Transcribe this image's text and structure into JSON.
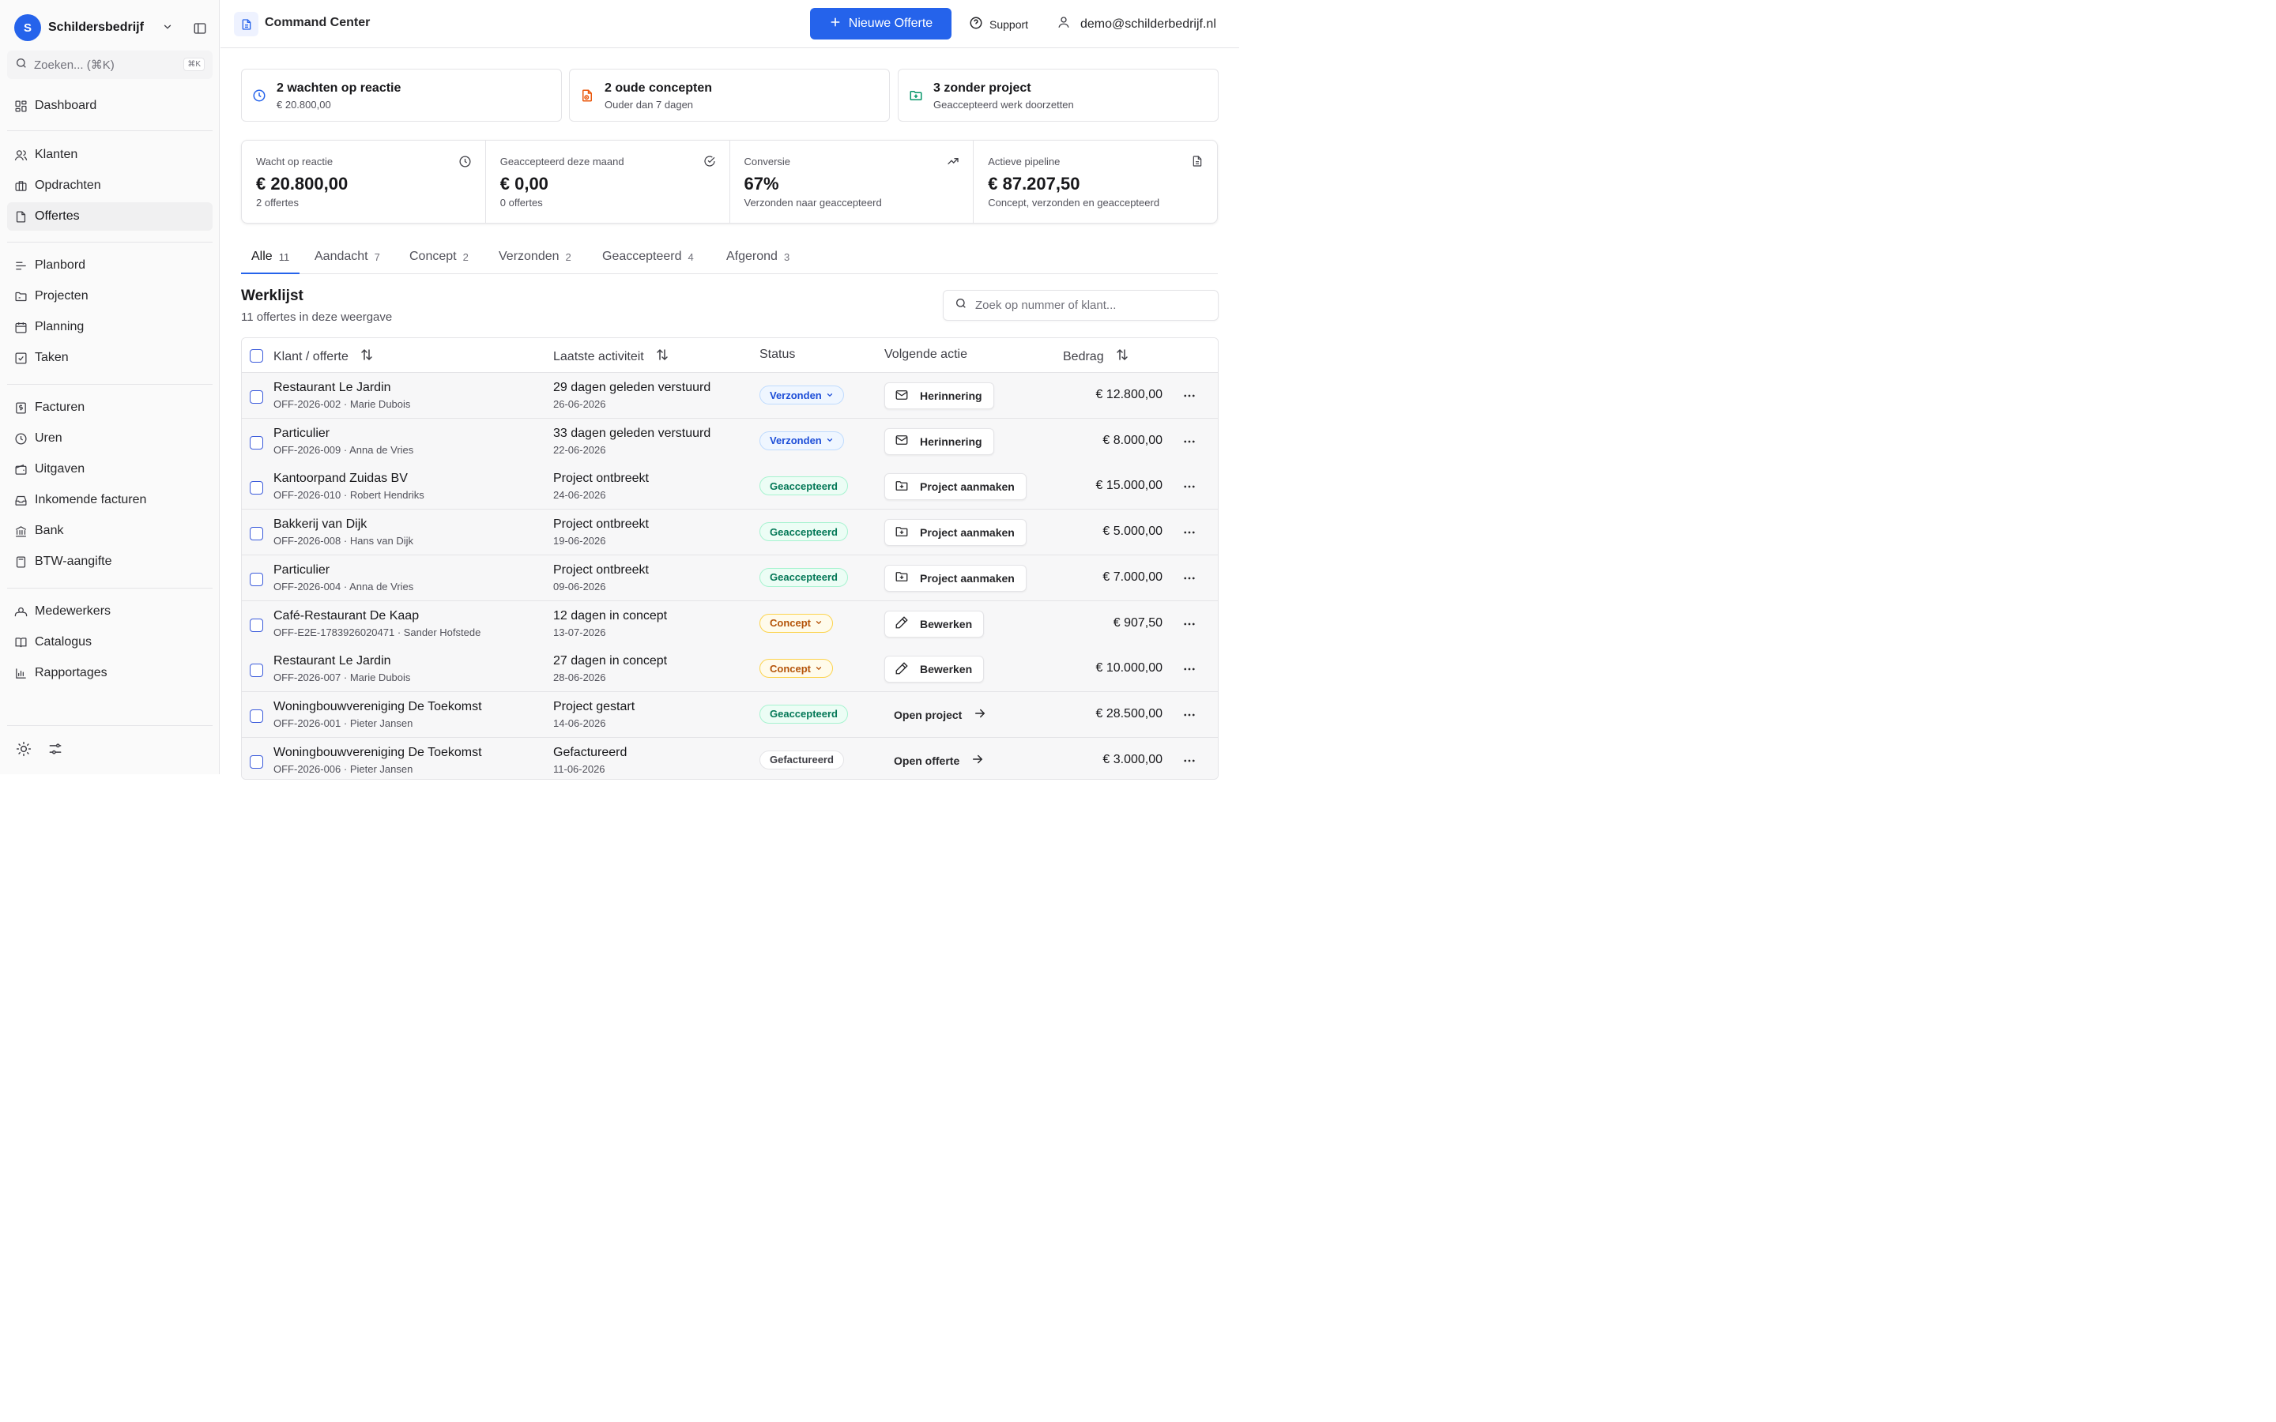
{
  "sidebar": {
    "org_initial": "S",
    "org_name": "Schildersbedrijf",
    "search_label": "Zoeken... (⌘K)",
    "search_shortcut": "⌘K",
    "items": [
      {
        "label": "Dashboard",
        "icon": "dashboard-icon"
      },
      {
        "label": "Klanten",
        "icon": "users-icon"
      },
      {
        "label": "Opdrachten",
        "icon": "briefcase-icon"
      },
      {
        "label": "Offertes",
        "icon": "file-icon",
        "active": true
      },
      {
        "label": "Planbord",
        "icon": "list-icon"
      },
      {
        "label": "Projecten",
        "icon": "folder-icon"
      },
      {
        "label": "Planning",
        "icon": "calendar-icon"
      },
      {
        "label": "Taken",
        "icon": "checkbox-icon"
      },
      {
        "label": "Facturen",
        "icon": "invoice-icon"
      },
      {
        "label": "Uren",
        "icon": "clock-icon"
      },
      {
        "label": "Uitgaven",
        "icon": "wallet-icon"
      },
      {
        "label": "Inkomende facturen",
        "icon": "inbox-icon"
      },
      {
        "label": "Bank",
        "icon": "bank-icon"
      },
      {
        "label": "BTW-aangifte",
        "icon": "calculator-icon"
      },
      {
        "label": "Medewerkers",
        "icon": "team-icon"
      },
      {
        "label": "Catalogus",
        "icon": "book-icon"
      },
      {
        "label": "Rapportages",
        "icon": "chart-icon"
      }
    ]
  },
  "header": {
    "title": "Command Center",
    "new_quote": "Nieuwe Offerte",
    "support": "Support",
    "user_email": "demo@schilderbedrijf.nl"
  },
  "alerts": [
    {
      "title": "2 wachten op reactie",
      "subtitle": "€ 20.800,00",
      "icon": "clock-icon",
      "color": "#2563eb"
    },
    {
      "title": "2 oude concepten",
      "subtitle": "Ouder dan 7 dagen",
      "icon": "file-clock-icon",
      "color": "#ea580c"
    },
    {
      "title": "3 zonder project",
      "subtitle": "Geaccepteerd werk doorzetten",
      "icon": "folder-plus-icon",
      "color": "#059669"
    }
  ],
  "kpis": [
    {
      "label": "Wacht op reactie",
      "value": "€ 20.800,00",
      "sub": "2 offertes",
      "icon": "clock-icon"
    },
    {
      "label": "Geaccepteerd deze maand",
      "value": "€ 0,00",
      "sub": "0 offertes",
      "icon": "check-circle-icon"
    },
    {
      "label": "Conversie",
      "value": "67%",
      "sub": "Verzonden naar geaccepteerd",
      "icon": "trending-up-icon"
    },
    {
      "label": "Actieve pipeline",
      "value": "€ 87.207,50",
      "sub": "Concept, verzonden en geaccepteerd",
      "icon": "document-icon"
    }
  ],
  "tabs": [
    {
      "label": "Alle",
      "count": "11",
      "active": true
    },
    {
      "label": "Aandacht",
      "count": "7"
    },
    {
      "label": "Concept",
      "count": "2"
    },
    {
      "label": "Verzonden",
      "count": "2"
    },
    {
      "label": "Geaccepteerd",
      "count": "4"
    },
    {
      "label": "Afgerond",
      "count": "3"
    }
  ],
  "worklist": {
    "title": "Werklijst",
    "subtitle": "11 offertes in deze weergave",
    "search_placeholder": "Zoek op nummer of klant..."
  },
  "table": {
    "headers": {
      "customer": "Klant / offerte",
      "activity": "Laatste activiteit",
      "status": "Status",
      "next": "Volgende actie",
      "amount": "Bedrag"
    },
    "rows": [
      {
        "customer": "Restaurant Le Jardin",
        "ref": "OFF-2026-002 · Marie Dubois",
        "activity": "29 dagen geleden verstuurd",
        "date": "26-06-2026",
        "status": "Verzonden",
        "status_kind": "verz",
        "action": "Herinnering",
        "action_icon": "mail-icon",
        "action_kind": "button",
        "amount": "€ 12.800,00"
      },
      {
        "customer": "Particulier",
        "ref": "OFF-2026-009 · Anna de Vries",
        "activity": "33 dagen geleden verstuurd",
        "date": "22-06-2026",
        "status": "Verzonden",
        "status_kind": "verz",
        "action": "Herinnering",
        "action_icon": "mail-icon",
        "action_kind": "button",
        "amount": "€ 8.000,00"
      },
      {
        "customer": "Kantoorpand Zuidas BV",
        "ref": "OFF-2026-010 · Robert Hendriks",
        "activity": "Project ontbreekt",
        "date": "24-06-2026",
        "status": "Geaccepteerd",
        "status_kind": "gea",
        "action": "Project aanmaken",
        "action_icon": "folder-plus-icon",
        "action_kind": "button",
        "amount": "€ 15.000,00"
      },
      {
        "customer": "Bakkerij van Dijk",
        "ref": "OFF-2026-008 · Hans van Dijk",
        "activity": "Project ontbreekt",
        "date": "19-06-2026",
        "status": "Geaccepteerd",
        "status_kind": "gea",
        "action": "Project aanmaken",
        "action_icon": "folder-plus-icon",
        "action_kind": "button",
        "amount": "€ 5.000,00"
      },
      {
        "customer": "Particulier",
        "ref": "OFF-2026-004 · Anna de Vries",
        "activity": "Project ontbreekt",
        "date": "09-06-2026",
        "status": "Geaccepteerd",
        "status_kind": "gea",
        "action": "Project aanmaken",
        "action_icon": "folder-plus-icon",
        "action_kind": "button",
        "amount": "€ 7.000,00"
      },
      {
        "customer": "Café-Restaurant De Kaap",
        "ref": "OFF-E2E-1783926020471 · Sander Hofstede",
        "activity": "12 dagen in concept",
        "date": "13-07-2026",
        "status": "Concept",
        "status_kind": "con",
        "action": "Bewerken",
        "action_icon": "pencil-icon",
        "action_kind": "button",
        "amount": "€ 907,50"
      },
      {
        "customer": "Restaurant Le Jardin",
        "ref": "OFF-2026-007 · Marie Dubois",
        "activity": "27 dagen in concept",
        "date": "28-06-2026",
        "status": "Concept",
        "status_kind": "con",
        "action": "Bewerken",
        "action_icon": "pencil-icon",
        "action_kind": "button",
        "amount": "€ 10.000,00"
      },
      {
        "customer": "Woningbouwvereniging De Toekomst",
        "ref": "OFF-2026-001 · Pieter Jansen",
        "activity": "Project gestart",
        "date": "14-06-2026",
        "status": "Geaccepteerd",
        "status_kind": "gea",
        "action": "Open project",
        "action_icon": "arrow-right-icon",
        "action_kind": "link",
        "amount": "€ 28.500,00"
      },
      {
        "customer": "Woningbouwvereniging De Toekomst",
        "ref": "OFF-2026-006 · Pieter Jansen",
        "activity": "Gefactureerd",
        "date": "11-06-2026",
        "status": "Gefactureerd",
        "status_kind": "gef",
        "action": "Open offerte",
        "action_icon": "arrow-right-icon",
        "action_kind": "link",
        "amount": "€ 3.000,00"
      }
    ]
  },
  "colors": {
    "accent": "#2563eb",
    "sidebar_bg": "#fafafa",
    "border": "#e4e4e7"
  }
}
